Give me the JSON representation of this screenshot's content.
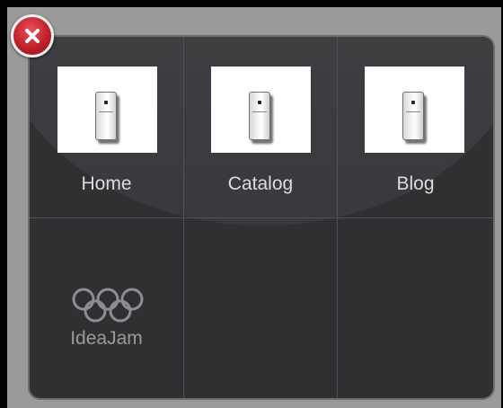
{
  "menu": {
    "items": [
      {
        "label": "Home",
        "icon": "phone-icon"
      },
      {
        "label": "Catalog",
        "icon": "phone-icon"
      },
      {
        "label": "Blog",
        "icon": "phone-icon"
      },
      {
        "label": "IdeaJam",
        "icon": "olympic-rings-icon"
      }
    ],
    "close_icon": "close-icon"
  },
  "colors": {
    "panel": "#303033",
    "close_button": "#c0202a",
    "label": "#dcdcdc",
    "label_dim": "#9a9a9c"
  }
}
